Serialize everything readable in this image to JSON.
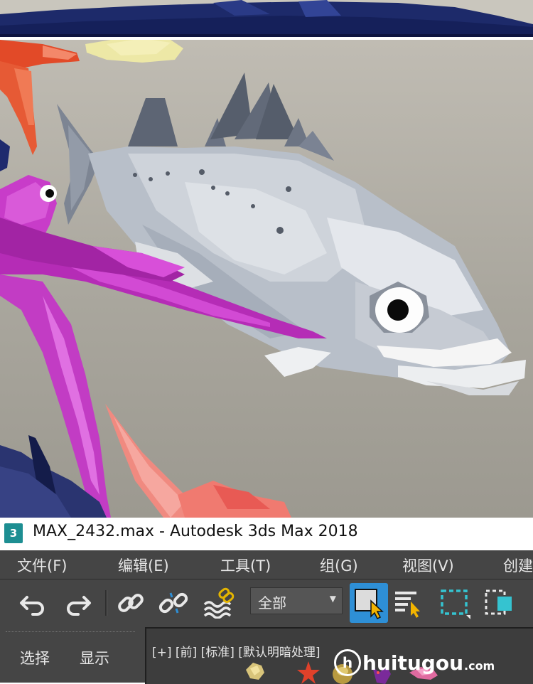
{
  "window": {
    "title": "MAX_2432.max - Autodesk 3ds Max 2018",
    "app_icon": "3ds-max-logo-icon",
    "app_icon_text": "3"
  },
  "menu": [
    {
      "label": "文件(F)"
    },
    {
      "label": "编辑(E)"
    },
    {
      "label": "工具(T)"
    },
    {
      "label": "组(G)"
    },
    {
      "label": "视图(V)"
    },
    {
      "label": "创建"
    }
  ],
  "toolbar": {
    "buttons": [
      {
        "icon": "undo-icon"
      },
      {
        "icon": "redo-icon"
      },
      {
        "icon": "link-icon"
      },
      {
        "icon": "unlink-icon"
      },
      {
        "icon": "bind-to-space-warp-icon"
      },
      {
        "icon": "select-object-icon"
      },
      {
        "icon": "select-by-name-icon"
      },
      {
        "icon": "rectangular-selection-region-icon"
      },
      {
        "icon": "window-crossing-icon"
      }
    ],
    "selection_filter": "全部"
  },
  "command_panel": {
    "tabs": [
      {
        "label": "选择"
      },
      {
        "label": "显示"
      }
    ]
  },
  "viewport": {
    "label": "[+] [前] [标准] [默认明暗处理]"
  },
  "watermark": {
    "icon_text": "h",
    "text": "huitugou",
    "suffix": ".com"
  },
  "colors": {
    "ui_background": "#454545",
    "accent_blue": "#2e8fd6",
    "app_teal": "#1d8e92",
    "render_background": "#b3b0a7"
  }
}
